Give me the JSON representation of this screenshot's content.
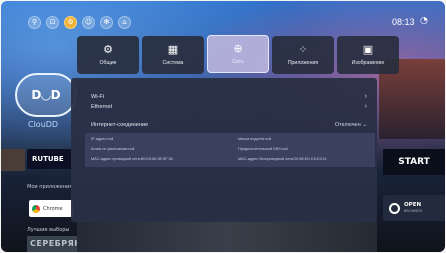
{
  "status": {
    "time": "08:13",
    "top_icons": [
      {
        "icon": "search-icon",
        "glyph": "⚲"
      },
      {
        "icon": "input-source-icon",
        "glyph": "⊡"
      },
      {
        "icon": "settings-icon",
        "glyph": "⚙"
      },
      {
        "icon": "gamepad-icon",
        "glyph": "☺"
      },
      {
        "icon": "fan-icon",
        "glyph": "✻"
      },
      {
        "icon": "home-icon",
        "glyph": "⌂"
      }
    ],
    "wifi_icon": "wifi-icon"
  },
  "categories": [
    {
      "label": "Общие",
      "icon": "gear-icon",
      "glyph": "⚙"
    },
    {
      "label": "Система",
      "icon": "system-grid-icon",
      "glyph": "▦"
    },
    {
      "label": "Сеть",
      "icon": "globe-icon",
      "glyph": "⊕"
    },
    {
      "label": "Приложения",
      "icon": "apps-icon",
      "glyph": "⁘"
    },
    {
      "label": "Изображение",
      "icon": "picture-icon",
      "glyph": "▣"
    }
  ],
  "active_category": "Сеть",
  "network": {
    "wifi_label": "Wi-Fi",
    "ethernet_label": "Ethernet",
    "internet_label": "Интернет-соединение",
    "internet_value": "Отключен",
    "details": {
      "ip": "IP-адрес:null",
      "mask": "Маска подсети:null",
      "gateway": "Шлюз по умолчанию:null",
      "dns": "Предпочтительный DNS:null",
      "mac_wired": "MAC-адрес проводной сети:80:D5:60:3E:5F:36",
      "mac_wireless": "MAC-адрес беспроводной сети:20:98:ED:C8:E3:21"
    }
  },
  "background": {
    "cloud_logo": "D◡D",
    "cloud_caption": "ClouDD",
    "rutube": "RUTUBE",
    "my_apps": "Мои приложения",
    "chrome": "Chrome",
    "best": "Лучшие выборы",
    "poster_text": "СЕРЕБРЯНЫЕ",
    "start": "START",
    "open_browser": "OPEN",
    "open_browser_sub": "BROWSER"
  }
}
